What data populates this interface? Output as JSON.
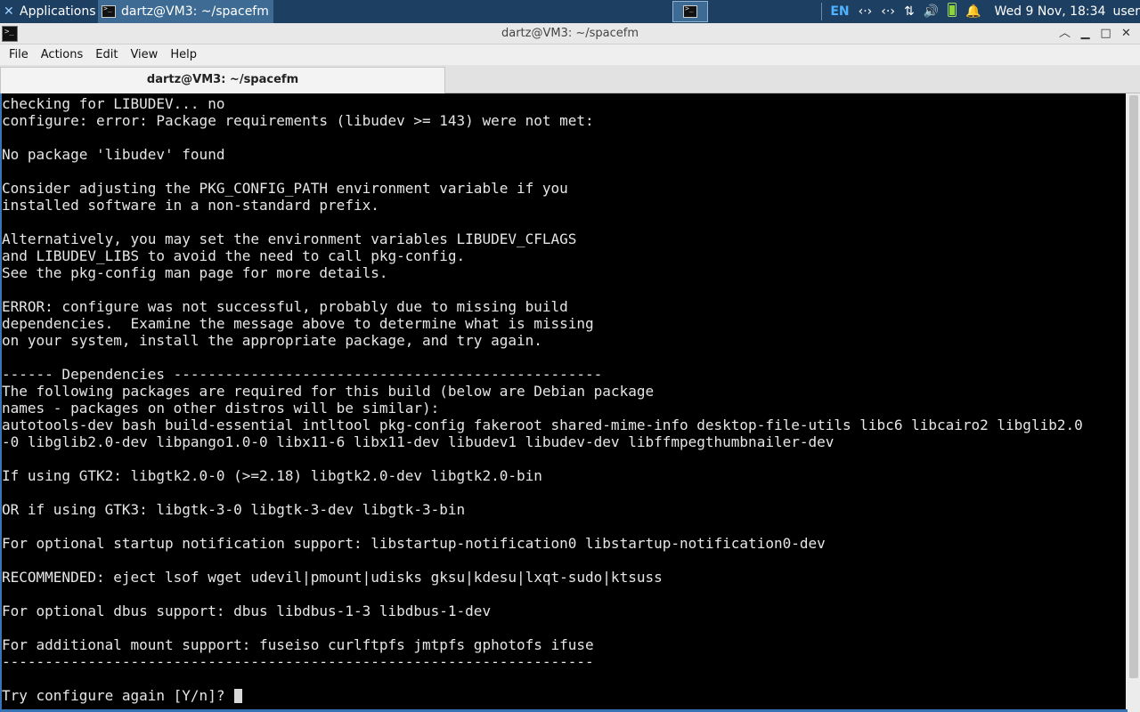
{
  "panel": {
    "applications_label": "Applications",
    "task_label": "dartz@VM3: ~/spacefm",
    "lang": "EN",
    "net1": "‹·›",
    "net2": "‹·›",
    "transfer": "⇅",
    "volume": "🔊",
    "notif": "🔔",
    "clock": "Wed  9 Nov, 18:34",
    "user": "user"
  },
  "window": {
    "title": "dartz@VM3: ~/spacefm",
    "minimize": "▁",
    "maximize": "□",
    "close": "✕",
    "rollup": "︿"
  },
  "menu": [
    "File",
    "Actions",
    "Edit",
    "View",
    "Help"
  ],
  "tab": {
    "label": "dartz@VM3: ~/spacefm"
  },
  "terminal": {
    "lines": [
      "checking for LIBUDEV... no",
      "configure: error: Package requirements (libudev >= 143) were not met:",
      "",
      "No package 'libudev' found",
      "",
      "Consider adjusting the PKG_CONFIG_PATH environment variable if you",
      "installed software in a non-standard prefix.",
      "",
      "Alternatively, you may set the environment variables LIBUDEV_CFLAGS",
      "and LIBUDEV_LIBS to avoid the need to call pkg-config.",
      "See the pkg-config man page for more details.",
      "",
      "ERROR: configure was not successful, probably due to missing build",
      "dependencies.  Examine the message above to determine what is missing",
      "on your system, install the appropriate package, and try again.",
      "",
      "------ Dependencies --------------------------------------------------",
      "The following packages are required for this build (below are Debian package",
      "names - packages on other distros will be similar):",
      "autotools-dev bash build-essential intltool pkg-config fakeroot shared-mime-info desktop-file-utils libc6 libcairo2 libglib2.0",
      "-0 libglib2.0-dev libpango1.0-0 libx11-6 libx11-dev libudev1 libudev-dev libffmpegthumbnailer-dev",
      "",
      "If using GTK2: libgtk2.0-0 (>=2.18) libgtk2.0-dev libgtk2.0-bin",
      "",
      "OR if using GTK3: libgtk-3-0 libgtk-3-dev libgtk-3-bin",
      "",
      "For optional startup notification support: libstartup-notification0 libstartup-notification0-dev",
      "",
      "RECOMMENDED: eject lsof wget udevil|pmount|udisks gksu|kdesu|lxqt-sudo|ktsuss",
      "",
      "For optional dbus support: dbus libdbus-1-3 libdbus-1-dev",
      "",
      "For additional mount support: fuseiso curlftpfs jmtpfs gphotofs ifuse",
      "---------------------------------------------------------------------",
      ""
    ],
    "prompt": "Try configure again [Y/n]? "
  }
}
